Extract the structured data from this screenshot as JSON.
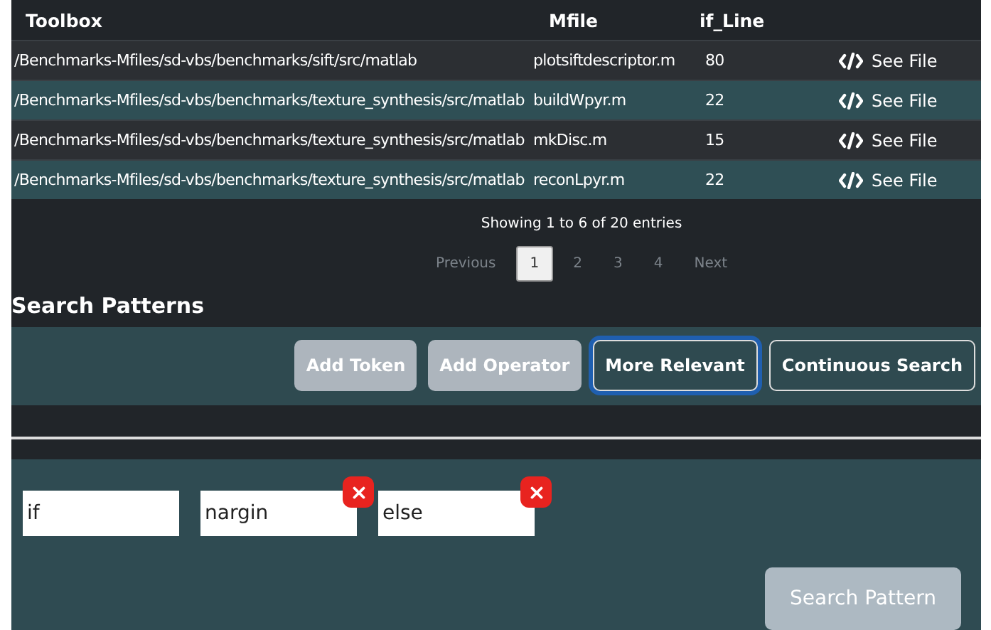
{
  "table": {
    "columns": [
      "Toolbox",
      "Mfile",
      "if_Line"
    ],
    "rows": [
      {
        "toolbox": "/Benchmarks-Mfiles/sd-vbs/benchmarks/sift/src/matlab",
        "mfile": "plotsiftdescriptor.m",
        "if_line": "80",
        "action": "See File"
      },
      {
        "toolbox": "/Benchmarks-Mfiles/sd-vbs/benchmarks/texture_synthesis/src/matlab",
        "mfile": "buildWpyr.m",
        "if_line": "22",
        "action": "See File"
      },
      {
        "toolbox": "/Benchmarks-Mfiles/sd-vbs/benchmarks/texture_synthesis/src/matlab",
        "mfile": "mkDisc.m",
        "if_line": "15",
        "action": "See File"
      },
      {
        "toolbox": "/Benchmarks-Mfiles/sd-vbs/benchmarks/texture_synthesis/src/matlab",
        "mfile": "reconLpyr.m",
        "if_line": "22",
        "action": "See File"
      }
    ],
    "info": "Showing 1 to 6 of 20 entries",
    "pagination": [
      {
        "label": "Previous",
        "selected": false
      },
      {
        "label": "1",
        "selected": true
      },
      {
        "label": "2",
        "selected": false
      },
      {
        "label": "3",
        "selected": false
      },
      {
        "label": "4",
        "selected": false
      },
      {
        "label": "Next",
        "selected": false
      }
    ]
  },
  "search_patterns": {
    "title": "Search Patterns",
    "buttons": [
      {
        "label": "Add Token",
        "kind": "filled",
        "focused": false
      },
      {
        "label": "Add Operator",
        "kind": "filled",
        "focused": false
      },
      {
        "label": "More Relevant",
        "kind": "outline",
        "focused": true
      },
      {
        "label": "Continuous Search",
        "kind": "outline",
        "focused": false
      }
    ],
    "tokens": [
      {
        "value": "if",
        "removable": false
      },
      {
        "value": "nargin",
        "removable": true
      },
      {
        "value": "else",
        "removable": true
      }
    ],
    "submit": {
      "label": "Search Pattern",
      "disabled": true
    }
  }
}
